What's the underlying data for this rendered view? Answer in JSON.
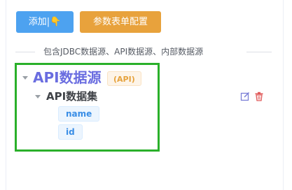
{
  "toolbar": {
    "add_label": "添加",
    "add_icon": "pointing-hand-icon",
    "config_label": "参数表单配置"
  },
  "divider": {
    "text": "包含JDBC数据源、API数据源、内部数据源"
  },
  "tree": {
    "root": {
      "label": "API数据源",
      "badge": "(API)"
    },
    "dataset": {
      "label": "API数据集",
      "fields": [
        "name",
        "id"
      ]
    }
  },
  "actions": {
    "edit_icon": "edit-icon",
    "delete_icon": "trash-icon"
  },
  "colors": {
    "primary": "#4da2f0",
    "warning": "#e8a23c",
    "highlight": "#2ab02a",
    "root_title": "#6a6de0",
    "danger": "#e05a5a"
  }
}
